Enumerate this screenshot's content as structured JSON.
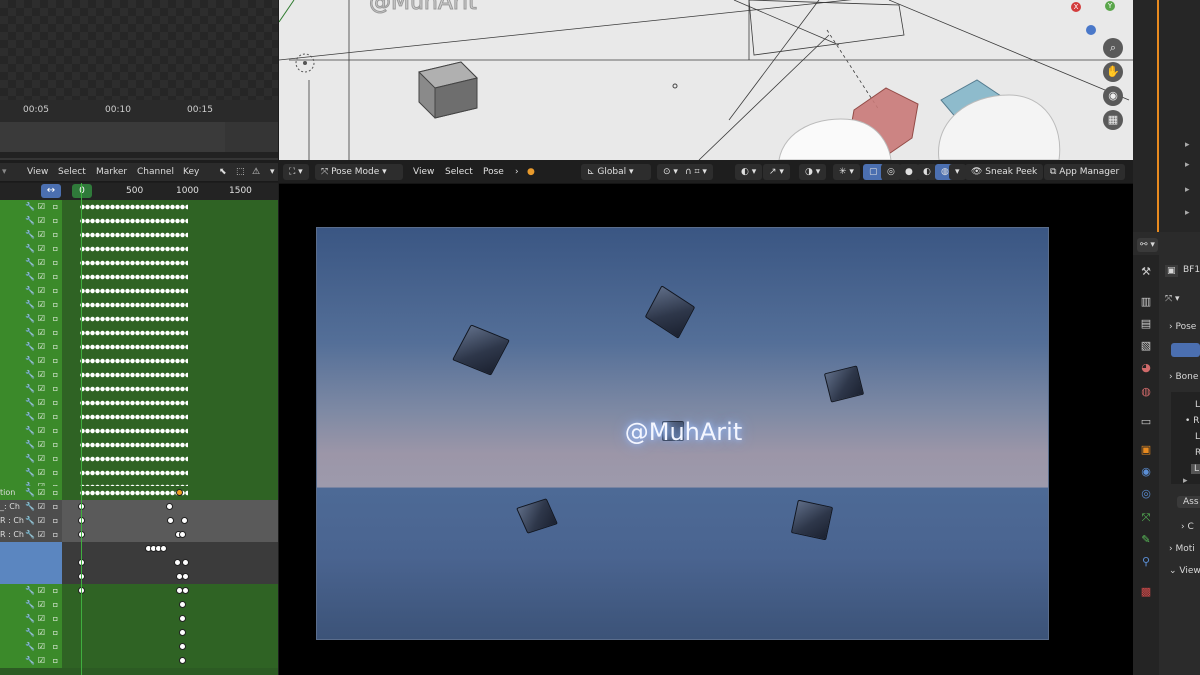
{
  "timeline": {
    "ruler_labels": [
      "00:05",
      "00:10",
      "00:15"
    ]
  },
  "dope_sheet": {
    "menu": [
      "View",
      "Select",
      "Marker",
      "Channel",
      "Key"
    ],
    "current_frame": "0",
    "ruler_labels": [
      "500",
      "1000",
      "1500"
    ],
    "range_icon": "↔",
    "channel_labels": {
      "action": "tion",
      "l_ch": "_: Ch",
      "r_ch1": "R : Ch",
      "r_ch2": "R : Ch"
    }
  },
  "viewport_header": {
    "mode": "Pose Mode",
    "menus": [
      "View",
      "Select",
      "Pose"
    ],
    "transform_orientation": "Global",
    "sneak_peek": "Sneak Peek",
    "app_manager": "App Manager"
  },
  "viewport_top": {
    "watermark": "@MuhArit",
    "gizmo": {
      "x": "X",
      "y": "Y"
    }
  },
  "render": {
    "watermark": "@MuhArit"
  },
  "properties": {
    "object_name": "BF1",
    "sections": [
      "Pose",
      "Bone",
      "Ass",
      "C",
      "Moti",
      "View"
    ],
    "list_items": [
      "L",
      "R",
      "L",
      "R",
      "L"
    ]
  },
  "colors": {
    "accent_blue": "#4b6fb0",
    "channel_green": "#3b8a2a",
    "playhead_green": "#3fae3f",
    "orange_line": "#e88a1f"
  }
}
